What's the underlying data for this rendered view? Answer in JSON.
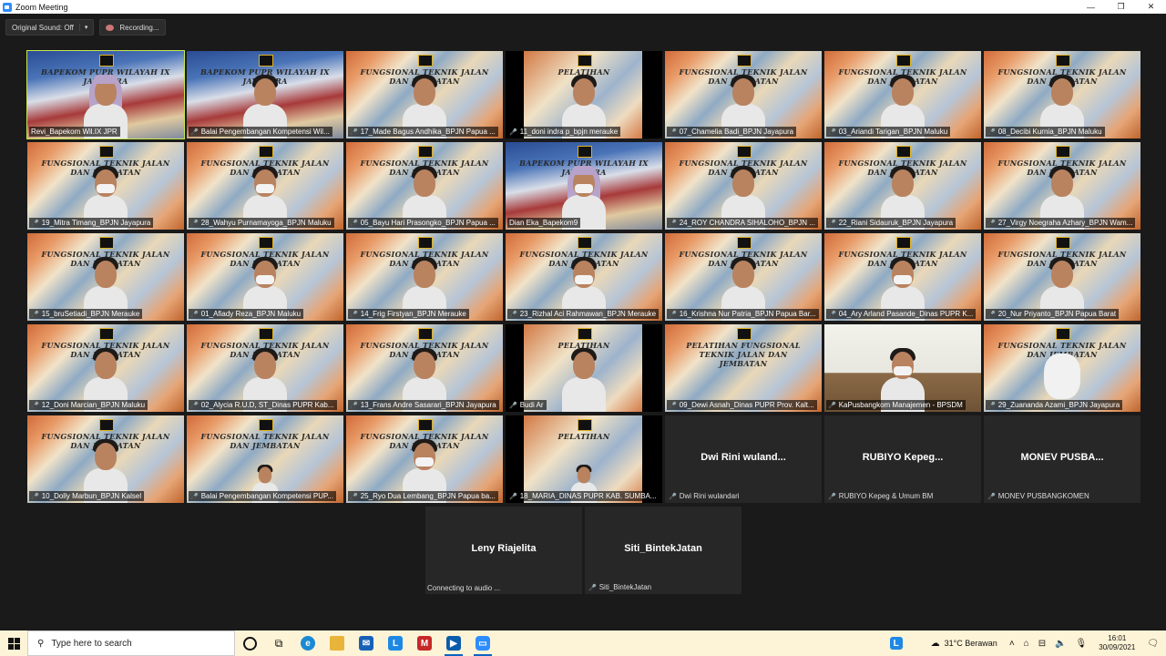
{
  "window": {
    "title": "Zoom Meeting",
    "min": "—",
    "restore": "❐",
    "close": "✕"
  },
  "controls": {
    "original_sound": "Original Sound: Off",
    "recording": "Recording..."
  },
  "tiles": [
    {
      "name": "Revi_Bapekom Wil.IX JPR",
      "banner": "BAPEKOM PUPR WILAYAH IX JAYAPURA",
      "variant": "v2",
      "person": "hijab",
      "active": true,
      "mic": false
    },
    {
      "name": "Balai Pengembangan Kompetensi Wil...",
      "banner": "BAPEKOM PUPR WILAYAH IX JAYAPURA",
      "variant": "v2",
      "person": "man",
      "mic": true
    },
    {
      "name": "17_Made Bagus Andhika_BPJN Papua ...",
      "banner": "FUNGSIONAL TEKNIK JALAN DAN JEMBATAN",
      "variant": "v1",
      "person": "man",
      "mic": true
    },
    {
      "name": "11_doni indra p_bpjn merauke",
      "banner": "PELATIHAN",
      "variant": "v3",
      "person": "man",
      "mic": true
    },
    {
      "name": "07_Chamelia Badi_BPJN Jayapura",
      "banner": "FUNGSIONAL TEKNIK JALAN DAN JEMBATAN",
      "variant": "v1",
      "person": "woman",
      "mic": true
    },
    {
      "name": "03_Ariandi Tarigan_BPJN Maluku",
      "banner": "FUNGSIONAL TEKNIK JALAN DAN JEMBATAN",
      "variant": "v1",
      "person": "man",
      "mic": true
    },
    {
      "name": "08_Decibi Kurnia_BPJN Maluku",
      "banner": "FUNGSIONAL TEKNIK JALAN DAN JEMBATAN",
      "variant": "v1",
      "person": "man",
      "mic": true
    },
    {
      "name": "19_Mitra Timang_BPJN Jayapura",
      "banner": "FUNGSIONAL TEKNIK JALAN DAN JEMBATAN",
      "variant": "v1",
      "person": "woman-mask",
      "mic": true
    },
    {
      "name": "28_Wahyu Purnamayoga_BPJN Maluku",
      "banner": "FUNGSIONAL TEKNIK JALAN DAN JEMBATAN",
      "variant": "v1",
      "person": "man-mask",
      "mic": true
    },
    {
      "name": "05_Bayu Hari Prasongko_BPJN Papua ...",
      "banner": "FUNGSIONAL TEKNIK JALAN DAN JEMBATAN",
      "variant": "v1",
      "person": "man",
      "mic": true
    },
    {
      "name": "Dian Eka_Bapekom9",
      "banner": "BAPEKOM PUPR WILAYAH IX JAYAPURA",
      "variant": "v2",
      "person": "hijab-mask",
      "mic": false
    },
    {
      "name": "24_ROY CHANDRA SIHALOHO_BPJN ...",
      "banner": "FUNGSIONAL TEKNIK JALAN DAN JEMBATAN",
      "variant": "v1",
      "person": "man",
      "mic": true
    },
    {
      "name": "22_Riani Sidauruk_BPJN Jayapura",
      "banner": "FUNGSIONAL TEKNIK JALAN DAN JEMBATAN",
      "variant": "v1",
      "person": "woman",
      "mic": true
    },
    {
      "name": "27_Virgy Noegraha Azhary_BPJN Wam...",
      "banner": "FUNGSIONAL TEKNIK JALAN DAN JEMBATAN",
      "variant": "v1",
      "person": "man",
      "mic": true
    },
    {
      "name": "15_bruSetiadi_BPJN Merauke",
      "banner": "FUNGSIONAL TEKNIK JALAN DAN JEMBATAN",
      "variant": "v1",
      "person": "man",
      "mic": true
    },
    {
      "name": "01_Afiady Reza_BPJN Maluku",
      "banner": "FUNGSIONAL TEKNIK JALAN DAN JEMBATAN",
      "variant": "v1",
      "person": "man-mask",
      "mic": true
    },
    {
      "name": "14_Frig Firstyan_BPJN Merauke",
      "banner": "FUNGSIONAL TEKNIK JALAN DAN JEMBATAN",
      "variant": "v1",
      "person": "man",
      "mic": true
    },
    {
      "name": "23_Rizhal Aci Rahmawan_BPJN Merauke",
      "banner": "FUNGSIONAL TEKNIK JALAN DAN JEMBATAN",
      "variant": "v1",
      "person": "man-mask",
      "mic": true
    },
    {
      "name": "16_Krishna Nur Patria_BPJN Papua Bar...",
      "banner": "FUNGSIONAL TEKNIK JALAN DAN JEMBATAN",
      "variant": "v1",
      "person": "man",
      "mic": true
    },
    {
      "name": "04_Ary Arland Pasande_Dinas PUPR K...",
      "banner": "FUNGSIONAL TEKNIK JALAN DAN JEMBATAN",
      "variant": "v1",
      "person": "man-mask",
      "mic": true
    },
    {
      "name": "20_Nur Priyanto_BPJN Papua Barat",
      "banner": "FUNGSIONAL TEKNIK JALAN DAN JEMBATAN",
      "variant": "v1",
      "person": "man",
      "mic": true
    },
    {
      "name": "12_Doni Marcian_BPJN Maluku",
      "banner": "FUNGSIONAL TEKNIK JALAN DAN JEMBATAN",
      "variant": "v1",
      "person": "man",
      "mic": true
    },
    {
      "name": "02_Alycia R.U.D, ST_Dinas PUPR Kab...",
      "banner": "FUNGSIONAL TEKNIK JALAN DAN JEMBATAN",
      "variant": "v1",
      "person": "woman",
      "mic": true
    },
    {
      "name": "13_Frans Andre Sasarari_BPJN Jayapura",
      "banner": "FUNGSIONAL TEKNIK JALAN DAN JEMBATAN",
      "variant": "v1",
      "person": "man",
      "mic": true
    },
    {
      "name": "Budi Ar",
      "banner": "PELATIHAN",
      "variant": "v3",
      "person": "man",
      "mic": true
    },
    {
      "name": "09_Dewi Asnah_Dinas PUPR Prov. Kalt...",
      "banner": "PELATIHAN FUNGSIONAL TEKNIK JALAN DAN JEMBATAN",
      "variant": "v1",
      "person": "none",
      "mic": true
    },
    {
      "name": "KaPusbangkom Manajemen - BPSDM",
      "banner": "",
      "variant": "v4",
      "person": "man-mask",
      "mic": true
    },
    {
      "name": "29_Zuananda Azami_BPJN Jayapura",
      "banner": "FUNGSIONAL TEKNIK JALAN DAN JEMBATAN",
      "variant": "v1",
      "person": "hand",
      "mic": true
    },
    {
      "name": "10_Dolly Marbun_BPJN Kalsel",
      "banner": "FUNGSIONAL TEKNIK JALAN DAN JEMBATAN",
      "variant": "v1",
      "person": "man",
      "mic": true
    },
    {
      "name": "Balai Pengembangan Kompetensi PUP...",
      "banner": "FUNGSIONAL TEKNIK JALAN DAN JEMBATAN",
      "variant": "v1",
      "person": "small",
      "mic": true
    },
    {
      "name": "25_Ryo Dua Lembang_BPJN Papua ba...",
      "banner": "FUNGSIONAL TEKNIK JALAN DAN JEMBATAN",
      "variant": "v1",
      "person": "man-mask",
      "mic": true
    },
    {
      "name": "18_MARIA_DINAS PUPR KAB. SUMBA...",
      "banner": "PELATIHAN",
      "variant": "v3",
      "person": "small",
      "mic": true
    },
    {
      "name": "Dwi Rini wulandari",
      "big": "Dwi Rini wuland...",
      "variant": "dark",
      "mic": true
    },
    {
      "name": "RUBIYO Kepeg & Umum BM",
      "big": "RUBIYO Kepeg...",
      "variant": "dark",
      "mic": true
    },
    {
      "name": "MONEV PUSBANGKOMEN",
      "big": "MONEV PUSBA...",
      "variant": "dark",
      "mic": true
    }
  ],
  "extra_tiles": [
    {
      "big": "Leny Riajelita",
      "status": "Connecting to audio ..."
    },
    {
      "big": "Siti_BintekJatan",
      "name": "Siti_BintekJatan",
      "mic": true
    }
  ],
  "taskbar": {
    "search_placeholder": "Type here to search",
    "weather": "31°C  Berawan",
    "time": "16:01",
    "date": "30/09/2021"
  }
}
